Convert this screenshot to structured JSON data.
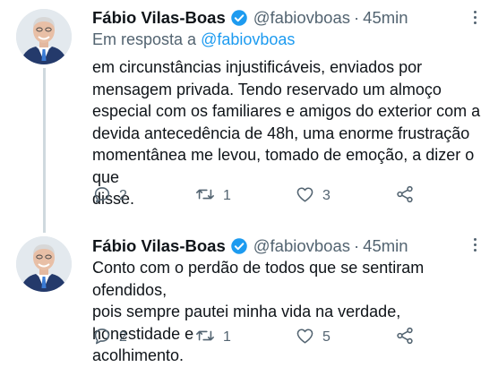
{
  "colors": {
    "accent": "#1d9bf0",
    "text": "#0f1419",
    "muted": "#536471",
    "thread_line": "#cfd9de"
  },
  "tweets": [
    {
      "author": "Fábio Vilas-Boas",
      "verified_icon": "verified-badge-icon",
      "handle": "@fabiovboas",
      "separator": "·",
      "time": "45min",
      "reply_prefix": "Em resposta a",
      "reply_handle": "@fabiovboas",
      "text": "em circunstâncias injustificáveis, enviados por\nmensagem privada. Tendo reservado um almoço\nespecial com os familiares e amigos do exterior com a\ndevida antecedência de 48h, uma enorme frustração\nmomentânea me levou, tomado de emoção, a dizer o que\ndisse.",
      "replies": "2",
      "retweets": "1",
      "likes": "3"
    },
    {
      "author": "Fábio Vilas-Boas",
      "verified_icon": "verified-badge-icon",
      "handle": "@fabiovboas",
      "separator": "·",
      "time": "45min",
      "text": "Conto com o perdão de todos que se sentiram ofendidos,\npois sempre pautei minha vida na verdade, honestidade e\nacolhimento.",
      "replies": "2",
      "retweets": "1",
      "likes": "5"
    }
  ]
}
